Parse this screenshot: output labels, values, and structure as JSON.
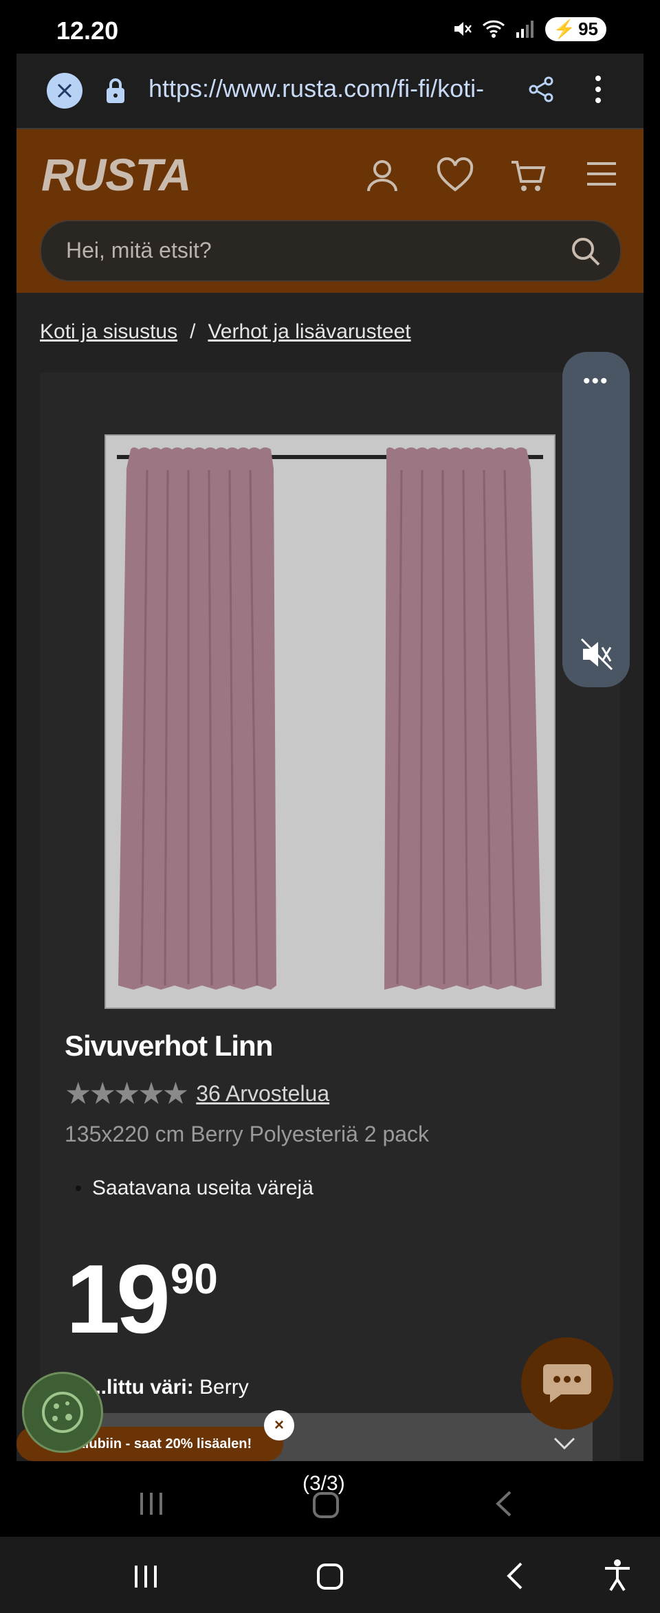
{
  "status_bar": {
    "time": "12.20",
    "battery": "95"
  },
  "browser": {
    "url": "https://www.rusta.com/fi-fi/koti-"
  },
  "site_header": {
    "logo": "RUSTA",
    "search_placeholder": "Hei, mitä etsit?"
  },
  "breadcrumb": {
    "items": [
      "Koti ja sisustus",
      "Verhot ja lisävarusteet"
    ],
    "separator": "/"
  },
  "product": {
    "title": "Sivuverhot Linn",
    "rating": 5,
    "rating_max": 5,
    "reviews_text": "36 Arvostelua",
    "variant_description": "135x220 cm Berry Polyesteriä 2 pack",
    "features": [
      "Saatavana useita värejä"
    ],
    "price_integer": "19",
    "price_decimals": "90",
    "selected_color_label": "...littu väri:",
    "selected_color_value": "Berry"
  },
  "club_banner": {
    "text": "Liity klubiin - saat 20% lisäalen!",
    "close": "×"
  },
  "page_indicator": "(3/3)",
  "icons": {
    "close_tab": "close-icon",
    "lock": "lock-icon",
    "share": "share-icon",
    "more": "kebab-icon",
    "account": "user-icon",
    "wishlist": "heart-icon",
    "cart": "cart-icon",
    "menu": "hamburger-icon",
    "search": "search-icon",
    "mute": "mute-icon",
    "chat": "chat-icon",
    "cookie": "cookie-icon"
  },
  "colors": {
    "brand": "#6b3406",
    "background": "#222222",
    "curtain": "#9c7683"
  }
}
